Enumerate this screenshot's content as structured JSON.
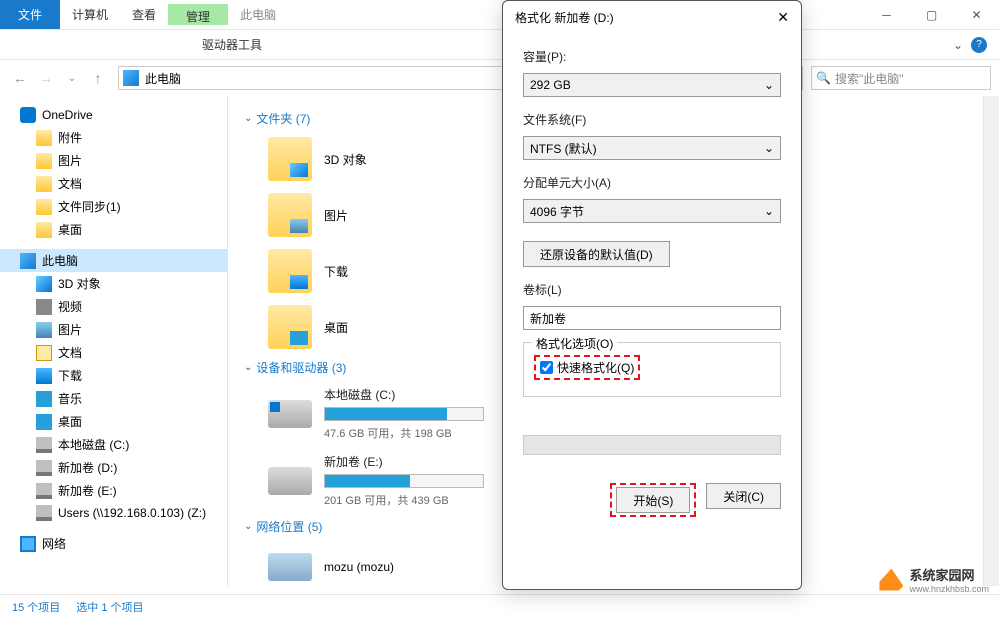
{
  "titlebar": {
    "file": "文件",
    "computer": "计算机",
    "view": "查看",
    "drive_tools_top": "管理",
    "drive_tools": "驱动器工具",
    "title": "此电脑"
  },
  "nav": {
    "location": "此电脑",
    "search_placeholder": "搜索\"此电脑\""
  },
  "sidebar": {
    "onedrive": "OneDrive",
    "items0": [
      "附件",
      "图片",
      "文档",
      "文件同步(1)",
      "桌面"
    ],
    "thispc": "此电脑",
    "items1": [
      "3D 对象",
      "视频",
      "图片",
      "文档",
      "下载",
      "音乐",
      "桌面",
      "本地磁盘 (C:)",
      "新加卷 (D:)",
      "新加卷 (E:)",
      "Users (\\\\192.168.0.103) (Z:)"
    ],
    "network": "网络"
  },
  "content": {
    "group_folders": "文件夹 (7)",
    "folders": [
      "3D 对象",
      "图片",
      "下载",
      "桌面"
    ],
    "group_drives": "设备和驱动器 (3)",
    "drives": [
      {
        "name": "本地磁盘 (C:)",
        "usage_pct": 77,
        "text": "47.6 GB 可用，共 198 GB"
      },
      {
        "name": "新加卷 (E:)",
        "usage_pct": 54,
        "text": "201 GB 可用，共 439 GB"
      }
    ],
    "group_network": "网络位置 (5)",
    "net_items": [
      "mozu (mozu)"
    ]
  },
  "dialog": {
    "title": "格式化 新加卷 (D:)",
    "capacity_label": "容量(P):",
    "capacity_value": "292 GB",
    "fs_label": "文件系统(F)",
    "fs_value": "NTFS (默认)",
    "alloc_label": "分配单元大小(A)",
    "alloc_value": "4096 字节",
    "restore_btn": "还原设备的默认值(D)",
    "volume_label": "卷标(L)",
    "volume_value": "新加卷",
    "options_legend": "格式化选项(O)",
    "quick_format": "快速格式化(Q)",
    "start_btn": "开始(S)",
    "close_btn": "关闭(C)"
  },
  "statusbar": {
    "items": "15 个项目",
    "selected": "选中 1 个项目"
  },
  "watermark": {
    "name": "系统家园网",
    "url": "www.hnzkhbsb.com"
  }
}
